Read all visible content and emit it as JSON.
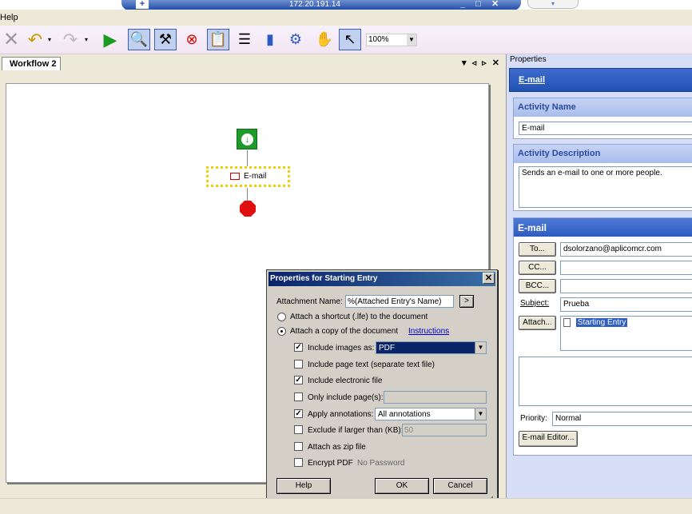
{
  "remote": {
    "host": "172.20.191.14",
    "minimize": "_",
    "restore": "□",
    "close": "✕"
  },
  "menu": {
    "help": "Help"
  },
  "toolbar": {
    "zoom": "100%",
    "icons": [
      "close-icon",
      "undo-icon",
      "redo-icon",
      "run-icon",
      "search-wizard-icon",
      "tools-icon",
      "stop-icon",
      "clipboard-icon",
      "checklist-icon",
      "chart-icon",
      "network-icon",
      "hand-icon",
      "pointer-icon"
    ]
  },
  "document": {
    "tab_label": "Workflow 2",
    "tab_controls": "▾ ◃ ▹ ✕",
    "email_node_label": "E-mail"
  },
  "properties": {
    "title": "Properties",
    "header": "E-mail",
    "activity_name": {
      "label": "Activity Name",
      "value": "E-mail"
    },
    "activity_description": {
      "label": "Activity Description",
      "value": "Sends an e-mail to one or more people."
    },
    "email": {
      "label": "E-mail",
      "to_button": "To...",
      "to_value": "dsolorzano@aplicomcr.com",
      "cc_button": "CC...",
      "cc_value": "",
      "bcc_button": "BCC...",
      "bcc_value": "",
      "subject_label": "Subject:",
      "subject_value": "Prueba",
      "attach_button": "Attach...",
      "attachment": "Starting Entry",
      "priority_label": "Priority:",
      "priority_value": "Normal",
      "editor_button": "E-mail Editor..."
    }
  },
  "dialog": {
    "title": "Properties for Starting Entry",
    "close": "✕",
    "attachment_name_label": "Attachment Name:",
    "attachment_name_value": "%(Attached Entry's Name)",
    "expand_button": ">",
    "radio_shortcut": "Attach a shortcut (.lfe) to the document",
    "radio_copy": "Attach a copy of the document",
    "instructions_link": "Instructions",
    "include_images_label": "Include images as:",
    "include_images_value": "PDF",
    "include_page_text": "Include page text (separate text file)",
    "include_electronic": "Include electronic file",
    "only_pages": "Only include page(s):",
    "apply_annotations": "Apply annotations:",
    "apply_annotations_value": "All annotations",
    "exclude_larger": "Exclude if larger than (KB):",
    "exclude_value": "50",
    "attach_zip": "Attach as zip file",
    "encrypt_pdf": "Encrypt PDF",
    "no_password": "No Password",
    "help_button": "Help",
    "ok_button": "OK",
    "cancel_button": "Cancel"
  }
}
